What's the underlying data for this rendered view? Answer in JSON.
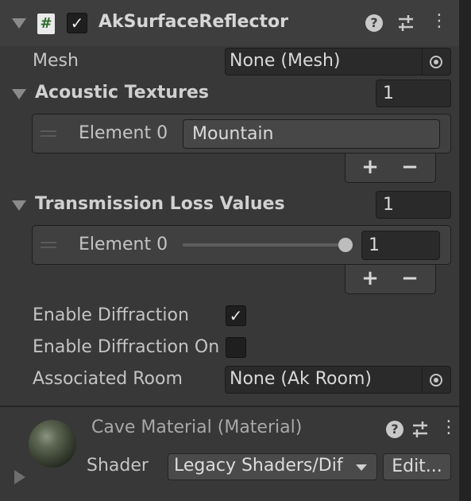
{
  "component": {
    "name": "AkSurfaceReflector",
    "enabled": true,
    "script_icon": "#"
  },
  "mesh": {
    "label": "Mesh",
    "value": "None (Mesh)"
  },
  "acoustic_textures": {
    "label": "Acoustic Textures",
    "size": "1",
    "element_label": "Element 0",
    "element_value": "Mountain",
    "add": "+",
    "remove": "−"
  },
  "transmission_loss": {
    "label": "Transmission Loss Values",
    "size": "1",
    "element_label": "Element 0",
    "element_value": "1",
    "slider_fraction": 1.0,
    "add": "+",
    "remove": "−"
  },
  "enable_diffraction": {
    "label": "Enable Diffraction",
    "checked": true
  },
  "enable_diffraction_on": {
    "label": "Enable Diffraction On",
    "checked": false
  },
  "associated_room": {
    "label": "Associated Room",
    "value": "None (Ak Room)"
  },
  "material": {
    "title": "Cave Material (Material)",
    "shader_label": "Shader",
    "shader_value": "Legacy Shaders/Dif",
    "edit_label": "Edit..."
  },
  "icons": {
    "checkmark": "✓",
    "help": "?",
    "more": "⋮"
  }
}
